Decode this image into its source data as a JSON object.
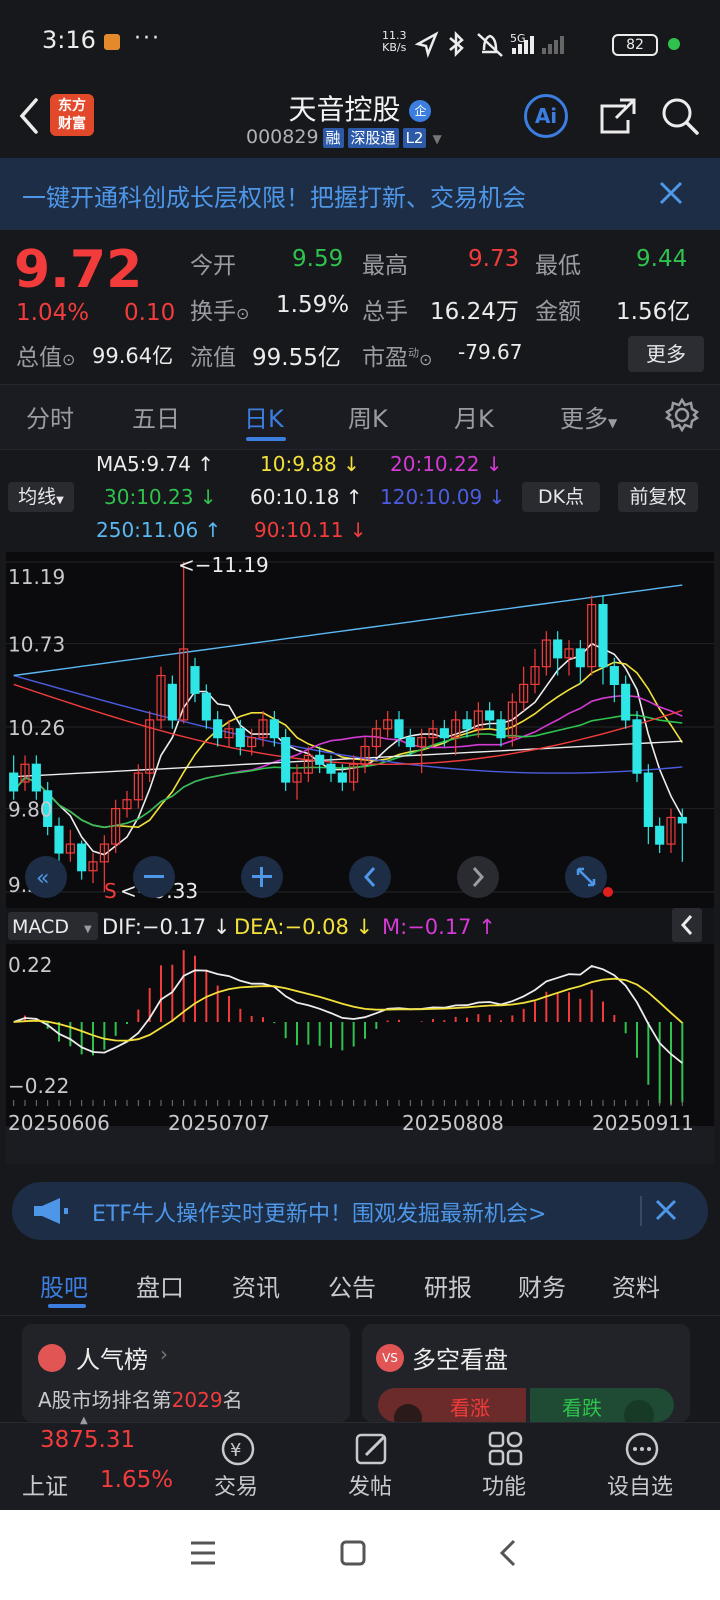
{
  "status_bar": {
    "time": "3:16",
    "menu_dots": "···",
    "speed_top": "11.3",
    "speed_bottom": "KB/s",
    "network": "5G",
    "battery": "82"
  },
  "header": {
    "title": "天音控股",
    "title_badge": "企",
    "code": "000829",
    "tag_margin": "融",
    "tag_connect": "深股通",
    "tag_level": "L2",
    "logo_top": "东方",
    "logo_bottom": "财富",
    "ai_label": "Ai"
  },
  "banner": {
    "text": "一键开通科创成长层权限！把握打新、交易机会"
  },
  "quote": {
    "price": "9.72",
    "change_pct": "1.04%",
    "change_amt": "0.10",
    "open_label": "今开",
    "open": "9.59",
    "high_label": "最高",
    "high": "9.73",
    "low_label": "最低",
    "low": "9.44",
    "turnover_label": "换手",
    "turnover": "1.59%",
    "volume_label": "总手",
    "volume": "16.24万",
    "amount_label": "金额",
    "amount": "1.56亿",
    "mcap_label": "总值",
    "mcap": "99.64亿",
    "float_label": "流值",
    "float": "99.55亿",
    "pe_label": "市盈",
    "pe_sup": "动",
    "pe": "-79.67",
    "more": "更多"
  },
  "ktabs": [
    "分时",
    "五日",
    "日K",
    "周K",
    "月K",
    "更多"
  ],
  "ma_legend": {
    "ma_selector": "均线",
    "dk": "DK点",
    "adjust": "前复权",
    "items": [
      {
        "text": "MA5:9.74 ↑",
        "color": "#ececec"
      },
      {
        "text": "10:9.88 ↓",
        "color": "#f2e13a"
      },
      {
        "text": "20:10.22 ↓",
        "color": "#d43ad4"
      },
      {
        "text": "30:10.23 ↓",
        "color": "#2fc24e"
      },
      {
        "text": "60:10.18 ↑",
        "color": "#ececec"
      },
      {
        "text": "120:10.09 ↓",
        "color": "#4b5de0"
      },
      {
        "text": "250:11.06 ↑",
        "color": "#5ab8f2"
      },
      {
        "text": "90:10.11 ↓",
        "color": "#f23c3c"
      }
    ]
  },
  "chart_data": {
    "type": "candlestick",
    "y_ticks": [
      "11.19",
      "10.73",
      "10.26",
      "9.80",
      "9.33"
    ],
    "ylim": [
      9.33,
      11.19
    ],
    "high_mark": "<−11.19",
    "low_mark": "<−9.33",
    "x_labels": [
      "20250606",
      "20250707",
      "20250808",
      "20250911"
    ],
    "candles": [
      [
        10.0,
        9.9,
        10.1,
        9.85
      ],
      [
        9.95,
        10.05,
        10.1,
        9.9
      ],
      [
        10.05,
        9.9,
        10.1,
        9.85
      ],
      [
        9.9,
        9.7,
        9.95,
        9.65
      ],
      [
        9.7,
        9.55,
        9.75,
        9.5
      ],
      [
        9.55,
        9.6,
        9.68,
        9.5
      ],
      [
        9.6,
        9.45,
        9.62,
        9.4
      ],
      [
        9.45,
        9.5,
        9.55,
        9.38
      ],
      [
        9.5,
        9.6,
        9.65,
        9.33
      ],
      [
        9.6,
        9.8,
        9.85,
        9.55
      ],
      [
        9.8,
        9.85,
        9.9,
        9.75
      ],
      [
        9.85,
        10.0,
        10.05,
        9.8
      ],
      [
        10.0,
        10.3,
        10.35,
        9.95
      ],
      [
        10.3,
        10.55,
        10.6,
        10.25
      ],
      [
        10.5,
        10.3,
        10.55,
        10.25
      ],
      [
        10.3,
        10.7,
        11.19,
        10.28
      ],
      [
        10.6,
        10.45,
        10.65,
        10.4
      ],
      [
        10.45,
        10.3,
        10.5,
        10.25
      ],
      [
        10.3,
        10.2,
        10.35,
        10.15
      ],
      [
        10.2,
        10.25,
        10.3,
        10.15
      ],
      [
        10.25,
        10.15,
        10.3,
        10.1
      ],
      [
        10.15,
        10.2,
        10.25,
        10.1
      ],
      [
        10.2,
        10.3,
        10.35,
        10.15
      ],
      [
        10.3,
        10.2,
        10.35,
        10.15
      ],
      [
        10.2,
        9.95,
        10.25,
        9.9
      ],
      [
        9.95,
        10.0,
        10.05,
        9.85
      ],
      [
        10.0,
        10.1,
        10.15,
        9.95
      ],
      [
        10.1,
        10.05,
        10.15,
        10.0
      ],
      [
        10.05,
        10.0,
        10.1,
        9.95
      ],
      [
        10.0,
        9.95,
        10.05,
        9.9
      ],
      [
        9.95,
        10.05,
        10.1,
        9.9
      ],
      [
        10.05,
        10.15,
        10.2,
        10.0
      ],
      [
        10.15,
        10.25,
        10.3,
        10.1
      ],
      [
        10.25,
        10.3,
        10.35,
        10.2
      ],
      [
        10.3,
        10.2,
        10.35,
        10.15
      ],
      [
        10.2,
        10.15,
        10.25,
        10.1
      ],
      [
        10.15,
        10.2,
        10.25,
        10.0
      ],
      [
        10.2,
        10.25,
        10.3,
        10.15
      ],
      [
        10.25,
        10.2,
        10.3,
        10.15
      ],
      [
        10.2,
        10.3,
        10.35,
        10.1
      ],
      [
        10.3,
        10.25,
        10.35,
        10.2
      ],
      [
        10.25,
        10.35,
        10.4,
        10.2
      ],
      [
        10.35,
        10.3,
        10.4,
        10.25
      ],
      [
        10.3,
        10.2,
        10.35,
        10.15
      ],
      [
        10.2,
        10.4,
        10.45,
        10.15
      ],
      [
        10.4,
        10.5,
        10.6,
        10.35
      ],
      [
        10.5,
        10.6,
        10.7,
        10.45
      ],
      [
        10.6,
        10.75,
        10.8,
        10.55
      ],
      [
        10.75,
        10.65,
        10.8,
        10.55
      ],
      [
        10.65,
        10.7,
        10.75,
        10.55
      ],
      [
        10.7,
        10.6,
        10.75,
        10.5
      ],
      [
        10.6,
        10.95,
        11.0,
        10.55
      ],
      [
        10.95,
        10.6,
        11.0,
        10.5
      ],
      [
        10.6,
        10.5,
        10.65,
        10.4
      ],
      [
        10.5,
        10.3,
        10.55,
        10.25
      ],
      [
        10.3,
        10.0,
        10.35,
        9.95
      ],
      [
        10.0,
        9.7,
        10.05,
        9.6
      ],
      [
        9.7,
        9.6,
        9.75,
        9.55
      ],
      [
        9.6,
        9.75,
        9.8,
        9.55
      ],
      [
        9.75,
        9.72,
        9.8,
        9.5
      ]
    ],
    "macd": {
      "selector": "MACD",
      "dif": "DIF:−0.17 ↓",
      "dea": "DEA:−0.08 ↓",
      "m": "M:−0.17 ↑",
      "y_ticks": [
        "0.22",
        "−0.22"
      ]
    }
  },
  "etf_banner": {
    "text": "ETF牛人操作实时更新中！围观发掘最新机会>"
  },
  "section_tabs": [
    "股吧",
    "盘口",
    "资讯",
    "公告",
    "研报",
    "财务",
    "资料"
  ],
  "cards": {
    "popularity_title": "人气榜",
    "popularity_text_pre": "A股市场排名第",
    "popularity_rank": "2029",
    "popularity_text_post": "名",
    "vs_title": "多空看盘",
    "bull": "看涨",
    "bear": "看跌"
  },
  "bottom_nav": {
    "index_value": "3875.31",
    "index_name": "上证",
    "index_pct": "1.65%",
    "items": [
      "交易",
      "发帖",
      "功能",
      "设自选"
    ]
  }
}
